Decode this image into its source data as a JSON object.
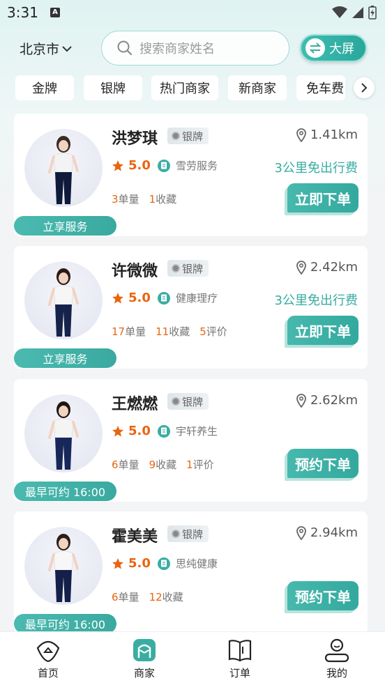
{
  "status": {
    "time": "3:31",
    "a_badge": "A"
  },
  "header": {
    "city": "北京市",
    "search_placeholder": "搜索商家姓名",
    "bigscreen_label": "大屏"
  },
  "chips": [
    "金牌",
    "银牌",
    "热门商家",
    "新商家",
    "免车费"
  ],
  "merchants": [
    {
      "name": "洪梦琪",
      "tier": "银牌",
      "distance": "1.41km",
      "rating": "5.0",
      "category": "雪劳服务",
      "free_travel": "3公里免出行费",
      "orders": "3",
      "orders_label": "单量",
      "favorites": "1",
      "favorites_label": "收藏",
      "reviews": "",
      "reviews_label": "",
      "order_button": "立即下单",
      "pill": "立享服务"
    },
    {
      "name": "许微微",
      "tier": "银牌",
      "distance": "2.42km",
      "rating": "5.0",
      "category": "健康理疗",
      "free_travel": "3公里免出行费",
      "orders": "17",
      "orders_label": "单量",
      "favorites": "11",
      "favorites_label": "收藏",
      "reviews": "5",
      "reviews_label": "评价",
      "order_button": "立即下单",
      "pill": "立享服务"
    },
    {
      "name": "王燃燃",
      "tier": "银牌",
      "distance": "2.62km",
      "rating": "5.0",
      "category": "宇轩养生",
      "free_travel": "",
      "orders": "6",
      "orders_label": "单量",
      "favorites": "9",
      "favorites_label": "收藏",
      "reviews": "1",
      "reviews_label": "评价",
      "order_button": "预约下单",
      "pill": "最早可约 16:00"
    },
    {
      "name": "霍美美",
      "tier": "银牌",
      "distance": "2.94km",
      "rating": "5.0",
      "category": "思纯健康",
      "free_travel": "",
      "orders": "6",
      "orders_label": "单量",
      "favorites": "12",
      "favorites_label": "收藏",
      "reviews": "",
      "reviews_label": "",
      "order_button": "预约下单",
      "pill": "最早可约 16:00"
    }
  ],
  "nav": [
    {
      "label": "首页",
      "icon": "home-icon"
    },
    {
      "label": "商家",
      "icon": "merchant-icon"
    },
    {
      "label": "订单",
      "icon": "order-book-icon"
    },
    {
      "label": "我的",
      "icon": "profile-icon"
    }
  ],
  "colors": {
    "accent": "#3aada2",
    "highlight": "#e8650f"
  }
}
